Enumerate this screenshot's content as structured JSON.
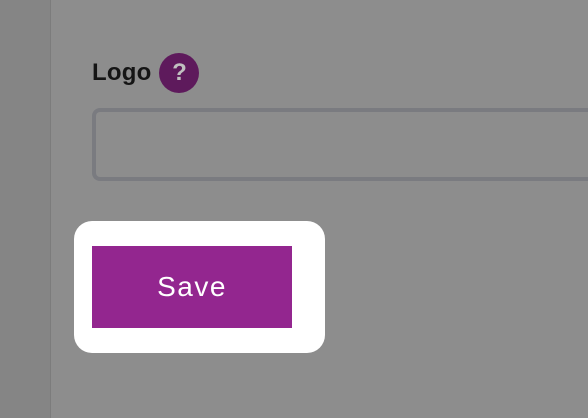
{
  "form": {
    "logo_field": {
      "label": "Logo",
      "help_symbol": "?",
      "help_icon": "question-mark-icon",
      "value": "",
      "placeholder": ""
    },
    "save_button": {
      "label": "Save"
    }
  },
  "colors": {
    "overlay_background": "#8d8d8d",
    "help_badge": "#5e1a5c",
    "save_button": "#93268f",
    "highlight": "#ffffff"
  }
}
